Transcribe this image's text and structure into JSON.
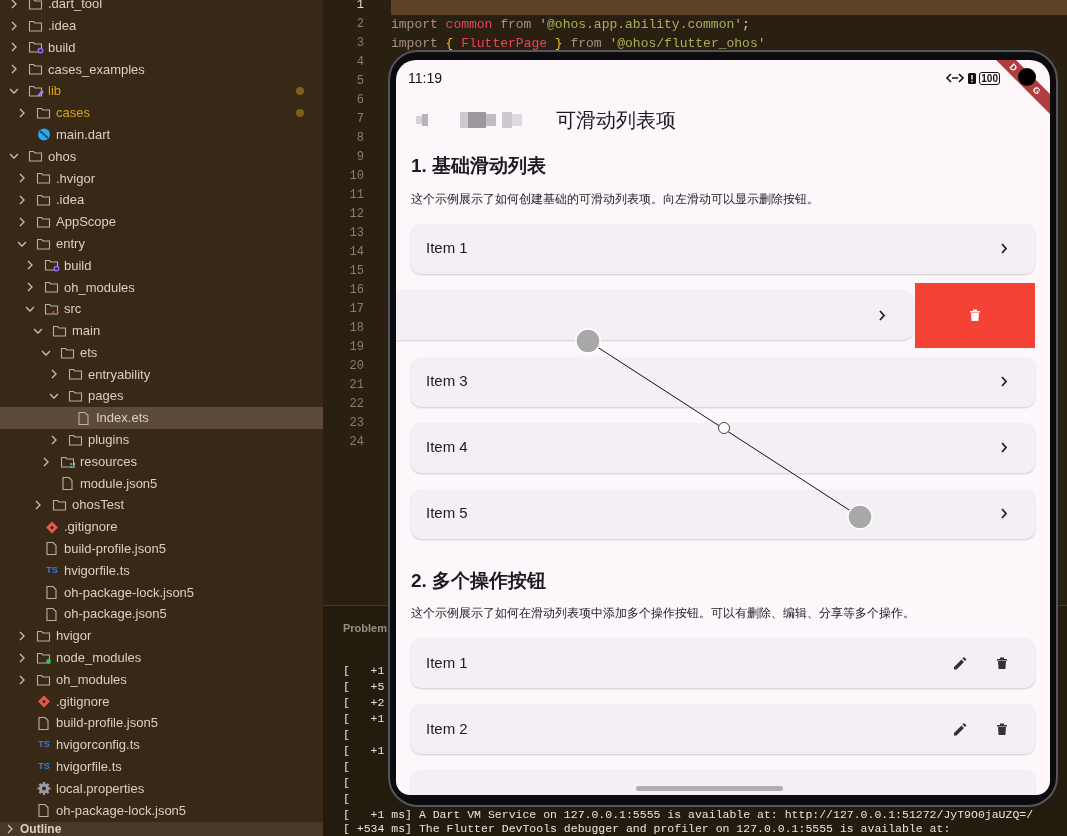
{
  "explorer": {
    "items": [
      {
        "name": ".dart_tool",
        "kind": "folder",
        "expanded": false,
        "modified": false,
        "selected": false
      },
      {
        "name": ".idea",
        "kind": "folder",
        "expanded": false,
        "modified": false,
        "selected": false
      },
      {
        "name": "build",
        "kind": "build-folder",
        "expanded": false,
        "modified": false,
        "selected": false
      },
      {
        "name": "cases_examples",
        "kind": "folder",
        "expanded": false,
        "modified": false,
        "selected": false
      },
      {
        "name": "lib",
        "kind": "lib-folder",
        "expanded": true,
        "modified": true,
        "selected": false,
        "children": [
          {
            "name": "cases",
            "kind": "folder",
            "expanded": false,
            "modified": true,
            "selected": false
          },
          {
            "name": "main.dart",
            "kind": "dart-file",
            "modified": false,
            "selected": false
          }
        ]
      },
      {
        "name": "ohos",
        "kind": "folder",
        "expanded": true,
        "modified": false,
        "selected": false,
        "children": [
          {
            "name": ".hvigor",
            "kind": "folder",
            "expanded": false,
            "modified": false,
            "selected": false
          },
          {
            "name": ".idea",
            "kind": "folder",
            "expanded": false,
            "modified": false,
            "selected": false
          },
          {
            "name": "AppScope",
            "kind": "folder",
            "expanded": false,
            "modified": false,
            "selected": false
          },
          {
            "name": "entry",
            "kind": "folder",
            "expanded": true,
            "modified": false,
            "selected": false,
            "children": [
              {
                "name": "build",
                "kind": "build-folder",
                "expanded": false,
                "modified": false,
                "selected": false
              },
              {
                "name": "oh_modules",
                "kind": "folder",
                "expanded": false,
                "modified": false,
                "selected": false
              },
              {
                "name": "src",
                "kind": "src-folder",
                "expanded": true,
                "modified": false,
                "selected": false,
                "children": [
                  {
                    "name": "main",
                    "kind": "folder",
                    "expanded": true,
                    "modified": false,
                    "selected": false,
                    "children": [
                      {
                        "name": "ets",
                        "kind": "folder",
                        "expanded": true,
                        "modified": false,
                        "selected": false,
                        "children": [
                          {
                            "name": "entryability",
                            "kind": "folder",
                            "expanded": false,
                            "modified": false,
                            "selected": false
                          },
                          {
                            "name": "pages",
                            "kind": "folder",
                            "expanded": true,
                            "modified": false,
                            "selected": false,
                            "children": [
                              {
                                "name": "Index.ets",
                                "kind": "file",
                                "modified": false,
                                "selected": true
                              }
                            ]
                          },
                          {
                            "name": "plugins",
                            "kind": "folder",
                            "expanded": false,
                            "modified": false,
                            "selected": false
                          }
                        ]
                      },
                      {
                        "name": "resources",
                        "kind": "resources-folder",
                        "expanded": false,
                        "modified": false,
                        "selected": false
                      },
                      {
                        "name": "module.json5",
                        "kind": "file",
                        "modified": false,
                        "selected": false
                      }
                    ]
                  },
                  {
                    "name": "ohosTest",
                    "kind": "folder",
                    "expanded": false,
                    "modified": false,
                    "selected": false
                  }
                ]
              },
              {
                "name": ".gitignore",
                "kind": "git-file",
                "modified": false,
                "selected": false
              },
              {
                "name": "build-profile.json5",
                "kind": "file",
                "modified": false,
                "selected": false
              },
              {
                "name": "hvigorfile.ts",
                "kind": "ts-file",
                "icon_text": "TS",
                "modified": false,
                "selected": false
              },
              {
                "name": "oh-package-lock.json5",
                "kind": "file",
                "modified": false,
                "selected": false
              },
              {
                "name": "oh-package.json5",
                "kind": "file",
                "modified": false,
                "selected": false
              }
            ]
          },
          {
            "name": "hvigor",
            "kind": "folder",
            "expanded": false,
            "modified": false,
            "selected": false
          },
          {
            "name": "node_modules",
            "kind": "node-folder",
            "expanded": false,
            "modified": false,
            "selected": false
          },
          {
            "name": "oh_modules",
            "kind": "folder",
            "expanded": false,
            "modified": false,
            "selected": false
          },
          {
            "name": ".gitignore",
            "kind": "git-file",
            "modified": false,
            "selected": false
          },
          {
            "name": "build-profile.json5",
            "kind": "file",
            "modified": false,
            "selected": false
          },
          {
            "name": "hvigorconfig.ts",
            "kind": "ts-file",
            "icon_text": "TS",
            "modified": false,
            "selected": false
          },
          {
            "name": "hvigorfile.ts",
            "kind": "ts-file",
            "icon_text": "TS",
            "modified": false,
            "selected": false
          },
          {
            "name": "local.properties",
            "kind": "settings-file",
            "modified": false,
            "selected": false
          },
          {
            "name": "oh-package-lock.json5",
            "kind": "file",
            "modified": false,
            "selected": false
          }
        ]
      }
    ],
    "outline": {
      "label": "Outline",
      "expanded": false
    }
  },
  "editor": {
    "lines": [
      {
        "number": "1",
        "current": true
      },
      {
        "number": "2",
        "current": false,
        "tokens": [
          {
            "text": "import",
            "kind": "keyword"
          },
          {
            "text": "common",
            "kind": "name"
          },
          {
            "text": "from",
            "kind": "keyword"
          },
          {
            "text": "'@ohos.app.ability.common'",
            "kind": "string"
          },
          {
            "text": ";",
            "kind": "punct"
          }
        ]
      },
      {
        "number": "3",
        "current": false,
        "tokens": [
          {
            "text": "import",
            "kind": "keyword"
          },
          {
            "text": "{",
            "kind": "brace"
          },
          {
            "text": "FlutterPage",
            "kind": "name"
          },
          {
            "text": "}",
            "kind": "brace"
          },
          {
            "text": "from",
            "kind": "keyword"
          },
          {
            "text": "'@ohos/flutter_ohos'",
            "kind": "string"
          }
        ]
      },
      {
        "number": "4",
        "current": false
      },
      {
        "number": "5",
        "current": false
      },
      {
        "number": "6",
        "current": false
      },
      {
        "number": "7",
        "current": false
      },
      {
        "number": "8",
        "current": false
      },
      {
        "number": "9",
        "current": false
      },
      {
        "number": "10",
        "current": false
      },
      {
        "number": "11",
        "current": false
      },
      {
        "number": "12",
        "current": false
      },
      {
        "number": "13",
        "current": false
      },
      {
        "number": "14",
        "current": false
      },
      {
        "number": "15",
        "current": false
      },
      {
        "number": "16",
        "current": false
      },
      {
        "number": "17",
        "current": false
      },
      {
        "number": "18",
        "current": false
      },
      {
        "number": "19",
        "current": false
      },
      {
        "number": "20",
        "current": false
      },
      {
        "number": "21",
        "current": false
      },
      {
        "number": "22",
        "current": false
      },
      {
        "number": "23",
        "current": false
      },
      {
        "number": "24",
        "current": false
      }
    ]
  },
  "panel": {
    "tab": "Problem",
    "lines": [
      "[   +1",
      "[   +5",
      "[   +2",
      "[   +1",
      "[",
      "[   +1",
      "[",
      "[",
      "[",
      "[   +1 ms] A Dart VM Service on 127.0.0.1:5555 is available at: http://127.0.0.1:51272/JyT9O0jaUZQ=/",
      "[ +534 ms] The Flutter DevTools debugger and profiler on 127.0.0.1:5555 is available at:"
    ]
  },
  "phone": {
    "status_bar": {
      "time": "11:19",
      "battery": "100"
    },
    "debug_banner_parts": [
      "D",
      "G"
    ],
    "title": "可滑动列表项",
    "sections": [
      {
        "heading": "1. 基础滑动列表",
        "description": "这个示例展示了如何创建基础的可滑动列表项。向左滑动可以显示删除按钮。",
        "kind": "swipe",
        "items": [
          {
            "label": "Item 1",
            "swiped": false
          },
          {
            "swiped": true
          },
          {
            "label": "Item 3",
            "swiped": false
          },
          {
            "label": "Item 4",
            "swiped": false
          },
          {
            "label": "Item 5",
            "swiped": false
          }
        ]
      },
      {
        "heading": "2. 多个操作按钮",
        "description": "这个示例展示了如何在滑动列表项中添加多个操作按钮。可以有删除、编辑、分享等多个操作。",
        "kind": "actions",
        "items": [
          {
            "label": "Item 1",
            "swiped": false
          },
          {
            "label": "Item 2",
            "swiped": false
          }
        ]
      }
    ]
  }
}
